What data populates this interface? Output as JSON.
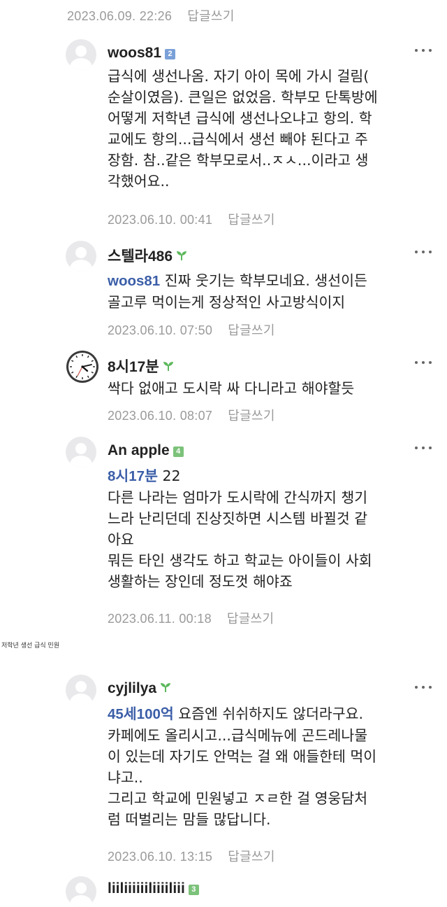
{
  "top": {
    "timestamp": "2023.06.09. 22:26",
    "reply": "답글쓰기"
  },
  "comments": [
    {
      "author": "woos81",
      "badge": "2",
      "lines": [
        "급식에 생선나옴. 자기 아이 목에 가시 걸림(",
        "순살이였음). 큰일은 없었음. 학부모 단톡방에",
        "어떻게 저학년 급식에 생선나오냐고 항의. 학",
        "교에도 항의...급식에서 생선 빼야 된다고 주",
        "장함. 참..같은 학부모로서..ㅈㅅ...이라고 생",
        "각했어요.."
      ],
      "timestamp": "2023.06.10. 00:41",
      "reply": "답글쓰기"
    },
    {
      "author": "스텔라486",
      "mention": "woos81",
      "first_line_rest": " 진짜 웃기는 학부모네요. 생선이든",
      "lines": [
        "골고루 먹이는게 정상적인 사고방식이지"
      ],
      "timestamp": "2023.06.10. 07:50",
      "reply": "답글쓰기"
    },
    {
      "author": "8시17분",
      "lines": [
        "싹다 없애고 도시락 싸 다니라고 해야할듯"
      ],
      "timestamp": "2023.06.10. 08:07",
      "reply": "답글쓰기"
    },
    {
      "author": "An apple",
      "badge": "4",
      "mention": "8시17분",
      "first_line_rest": " 22",
      "lines": [
        "다른 나라는 엄마가 도시락에 간식까지 챙기",
        "느라 난리던데 진상짓하면 시스템 바뀔것 같",
        "아요",
        "뭐든 타인 생각도 하고 학교는 아이들이 사회",
        "생활하는 장인데 정도껏 해야죠"
      ],
      "timestamp": "2023.06.11. 00:18",
      "reply": "답글쓰기"
    },
    {
      "author": "cyjlilya",
      "mention": "45세100억",
      "first_line_rest": " 요즘엔 쉬쉬하지도 않더라구요.",
      "lines": [
        "카페에도 올리시고...급식메뉴에 곤드레나물",
        "이 있는데 자기도 안먹는 걸 왜 애들한테 먹이",
        "냐고..",
        "그리고 학교에 민원넣고 ㅈㄹ한 걸 영웅담처",
        "럼 떠벌리는 맘들 많답니다."
      ],
      "timestamp": "2023.06.10. 13:15",
      "reply": "답글쓰기"
    },
    {
      "author": "liiliiiiiiliiiiliii",
      "badge": "3"
    }
  ],
  "caption": "저학년 생선 급식 민원",
  "colors": {
    "mention": "#3b5ea8",
    "meta": "#9a9a9a",
    "sprout": "#5cb85c",
    "badge2": "#7aa0d8",
    "badge4": "#7cc27a",
    "badge3": "#7cc27a"
  }
}
